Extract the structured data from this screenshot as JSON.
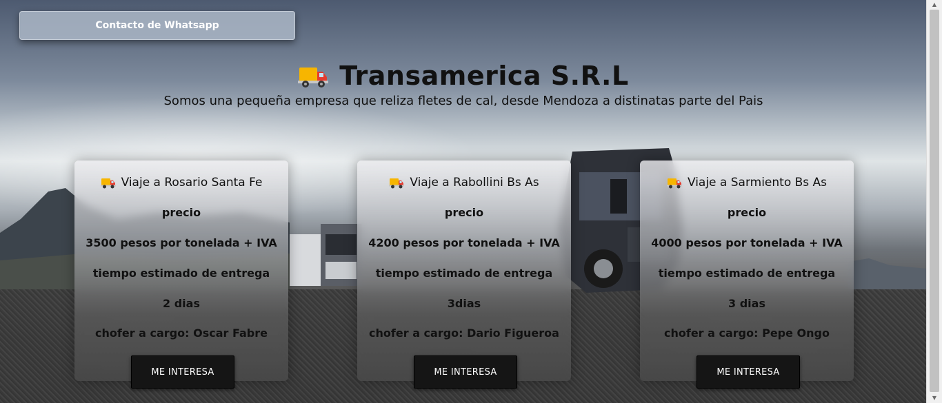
{
  "whatsapp": {
    "label": "Contacto de Whatsapp"
  },
  "header": {
    "icon": "delivery-truck-icon",
    "title": "Transamerica S.R.L",
    "subtitle": "Somos una pequeña empresa que reliza fletes de cal, desde Mendoza a distinatas parte del Pais"
  },
  "cards": [
    {
      "icon": "delivery-truck-icon",
      "title": "Viaje a Rosario Santa Fe",
      "price_label": "precio",
      "price": "3500 pesos por tonelada + IVA",
      "time_label": "tiempo estimado de entrega",
      "time": "2 dias",
      "driver": "chofer a cargo: Oscar Fabre",
      "button": "ME INTERESA"
    },
    {
      "icon": "delivery-truck-icon",
      "title": "Viaje a Rabollini Bs As",
      "price_label": "precio",
      "price": "4200 pesos por tonelada + IVA",
      "time_label": "tiempo estimado de entrega",
      "time": "3dias",
      "driver": "chofer a cargo: Dario Figueroa",
      "button": "ME INTERESA"
    },
    {
      "icon": "delivery-truck-icon",
      "title": "Viaje a Sarmiento Bs As",
      "price_label": "precio",
      "price": "4000 pesos por tonelada + IVA",
      "time_label": "tiempo estimado de entrega",
      "time": "3 dias",
      "driver": "chofer a cargo: Pepe Ongo",
      "button": "ME INTERESA"
    }
  ]
}
